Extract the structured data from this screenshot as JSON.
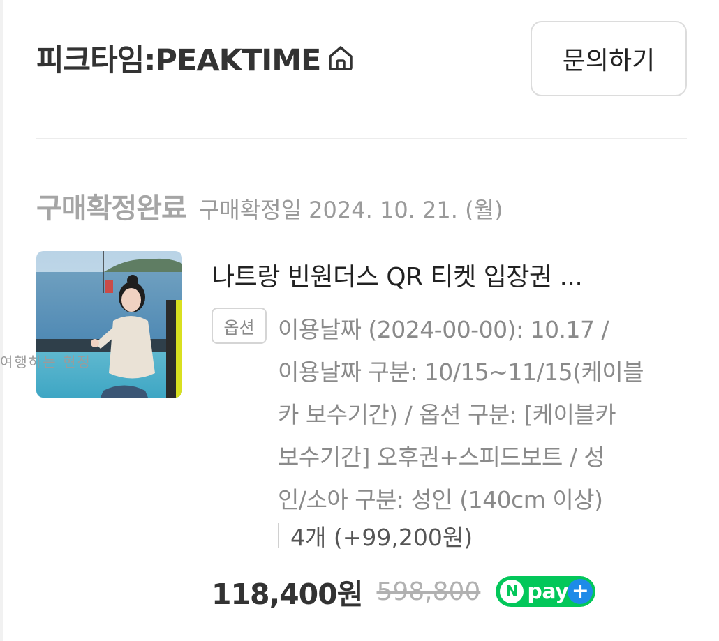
{
  "store": {
    "name": "피크타임:PEAKTIME",
    "home_icon": "home-icon"
  },
  "header": {
    "inquiry_label": "문의하기"
  },
  "order": {
    "status": "구매확정완료",
    "confirm_date": "구매확정일 2024. 10. 21. (월)",
    "watermark": "여행하는 현정",
    "product_title": "나트랑 빈원더스 QR 티켓 입장권 ...",
    "option_badge": "옵션",
    "option_lines": [
      "이용날짜 (2024-00-00): 10.17 /",
      "이용날짜 구분: 10/15~11/15(케이블",
      "카 보수기간) / 옵션 구분: [케이블카",
      "보수기간] 오후권+스피드보트 / 성",
      "인/소아 구분: 성인 (140cm 이상)"
    ],
    "quantity": "4개 (+99,200원)",
    "price": "118,400원",
    "original_price": "598,800",
    "npay": {
      "n": "N",
      "label": "pay",
      "plus": "+",
      "color": "#03c75a",
      "plus_color": "#1e8be8"
    }
  }
}
